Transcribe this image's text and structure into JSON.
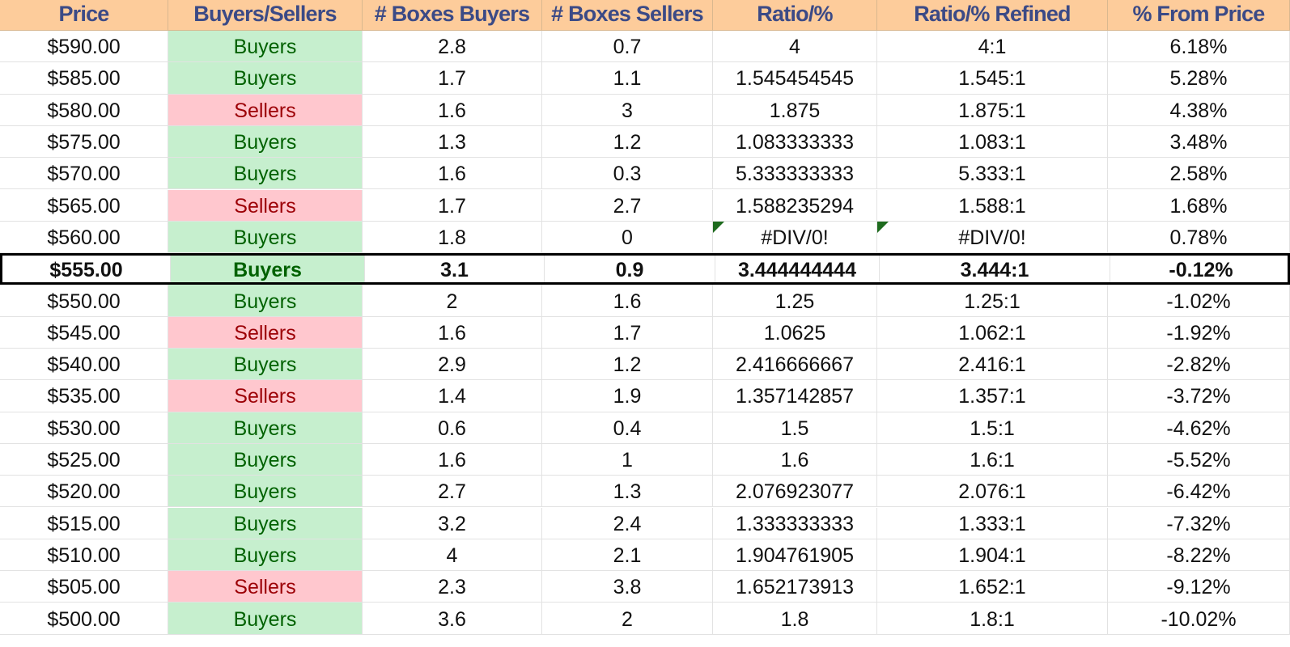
{
  "headers": [
    "Price",
    "Buyers/Sellers",
    "# Boxes Buyers",
    "# Boxes Sellers",
    "Ratio/%",
    "Ratio/% Refined",
    "% From Price"
  ],
  "colors": {
    "header_bg": "#fdcc9b",
    "header_text": "#3b4a86",
    "buyers_bg": "#c6efce",
    "buyers_text": "#006100",
    "sellers_bg": "#ffc7ce",
    "sellers_text": "#9c0006",
    "error_flag": "#1e6b1e"
  },
  "highlight_price": "$555.00",
  "rows": [
    {
      "price": "$590.00",
      "side": "Buyers",
      "boxes_buyers": "2.8",
      "boxes_sellers": "0.7",
      "ratio": "4",
      "ratio_refined": "4:1",
      "from_price": "6.18%"
    },
    {
      "price": "$585.00",
      "side": "Buyers",
      "boxes_buyers": "1.7",
      "boxes_sellers": "1.1",
      "ratio": "1.545454545",
      "ratio_refined": "1.545:1",
      "from_price": "5.28%"
    },
    {
      "price": "$580.00",
      "side": "Sellers",
      "boxes_buyers": "1.6",
      "boxes_sellers": "3",
      "ratio": "1.875",
      "ratio_refined": "1.875:1",
      "from_price": "4.38%"
    },
    {
      "price": "$575.00",
      "side": "Buyers",
      "boxes_buyers": "1.3",
      "boxes_sellers": "1.2",
      "ratio": "1.083333333",
      "ratio_refined": "1.083:1",
      "from_price": "3.48%"
    },
    {
      "price": "$570.00",
      "side": "Buyers",
      "boxes_buyers": "1.6",
      "boxes_sellers": "0.3",
      "ratio": "5.333333333",
      "ratio_refined": "5.333:1",
      "from_price": "2.58%"
    },
    {
      "price": "$565.00",
      "side": "Sellers",
      "boxes_buyers": "1.7",
      "boxes_sellers": "2.7",
      "ratio": "1.588235294",
      "ratio_refined": "1.588:1",
      "from_price": "1.68%"
    },
    {
      "price": "$560.00",
      "side": "Buyers",
      "boxes_buyers": "1.8",
      "boxes_sellers": "0",
      "ratio": "#DIV/0!",
      "ratio_refined": "#DIV/0!",
      "from_price": "0.78%",
      "error": true
    },
    {
      "price": "$555.00",
      "side": "Buyers",
      "boxes_buyers": "3.1",
      "boxes_sellers": "0.9",
      "ratio": "3.444444444",
      "ratio_refined": "3.444:1",
      "from_price": "-0.12%"
    },
    {
      "price": "$550.00",
      "side": "Buyers",
      "boxes_buyers": "2",
      "boxes_sellers": "1.6",
      "ratio": "1.25",
      "ratio_refined": "1.25:1",
      "from_price": "-1.02%"
    },
    {
      "price": "$545.00",
      "side": "Sellers",
      "boxes_buyers": "1.6",
      "boxes_sellers": "1.7",
      "ratio": "1.0625",
      "ratio_refined": "1.062:1",
      "from_price": "-1.92%"
    },
    {
      "price": "$540.00",
      "side": "Buyers",
      "boxes_buyers": "2.9",
      "boxes_sellers": "1.2",
      "ratio": "2.416666667",
      "ratio_refined": "2.416:1",
      "from_price": "-2.82%"
    },
    {
      "price": "$535.00",
      "side": "Sellers",
      "boxes_buyers": "1.4",
      "boxes_sellers": "1.9",
      "ratio": "1.357142857",
      "ratio_refined": "1.357:1",
      "from_price": "-3.72%"
    },
    {
      "price": "$530.00",
      "side": "Buyers",
      "boxes_buyers": "0.6",
      "boxes_sellers": "0.4",
      "ratio": "1.5",
      "ratio_refined": "1.5:1",
      "from_price": "-4.62%"
    },
    {
      "price": "$525.00",
      "side": "Buyers",
      "boxes_buyers": "1.6",
      "boxes_sellers": "1",
      "ratio": "1.6",
      "ratio_refined": "1.6:1",
      "from_price": "-5.52%"
    },
    {
      "price": "$520.00",
      "side": "Buyers",
      "boxes_buyers": "2.7",
      "boxes_sellers": "1.3",
      "ratio": "2.076923077",
      "ratio_refined": "2.076:1",
      "from_price": "-6.42%"
    },
    {
      "price": "$515.00",
      "side": "Buyers",
      "boxes_buyers": "3.2",
      "boxes_sellers": "2.4",
      "ratio": "1.333333333",
      "ratio_refined": "1.333:1",
      "from_price": "-7.32%"
    },
    {
      "price": "$510.00",
      "side": "Buyers",
      "boxes_buyers": "4",
      "boxes_sellers": "2.1",
      "ratio": "1.904761905",
      "ratio_refined": "1.904:1",
      "from_price": "-8.22%"
    },
    {
      "price": "$505.00",
      "side": "Sellers",
      "boxes_buyers": "2.3",
      "boxes_sellers": "3.8",
      "ratio": "1.652173913",
      "ratio_refined": "1.652:1",
      "from_price": "-9.12%"
    },
    {
      "price": "$500.00",
      "side": "Buyers",
      "boxes_buyers": "3.6",
      "boxes_sellers": "2",
      "ratio": "1.8",
      "ratio_refined": "1.8:1",
      "from_price": "-10.02%"
    }
  ]
}
